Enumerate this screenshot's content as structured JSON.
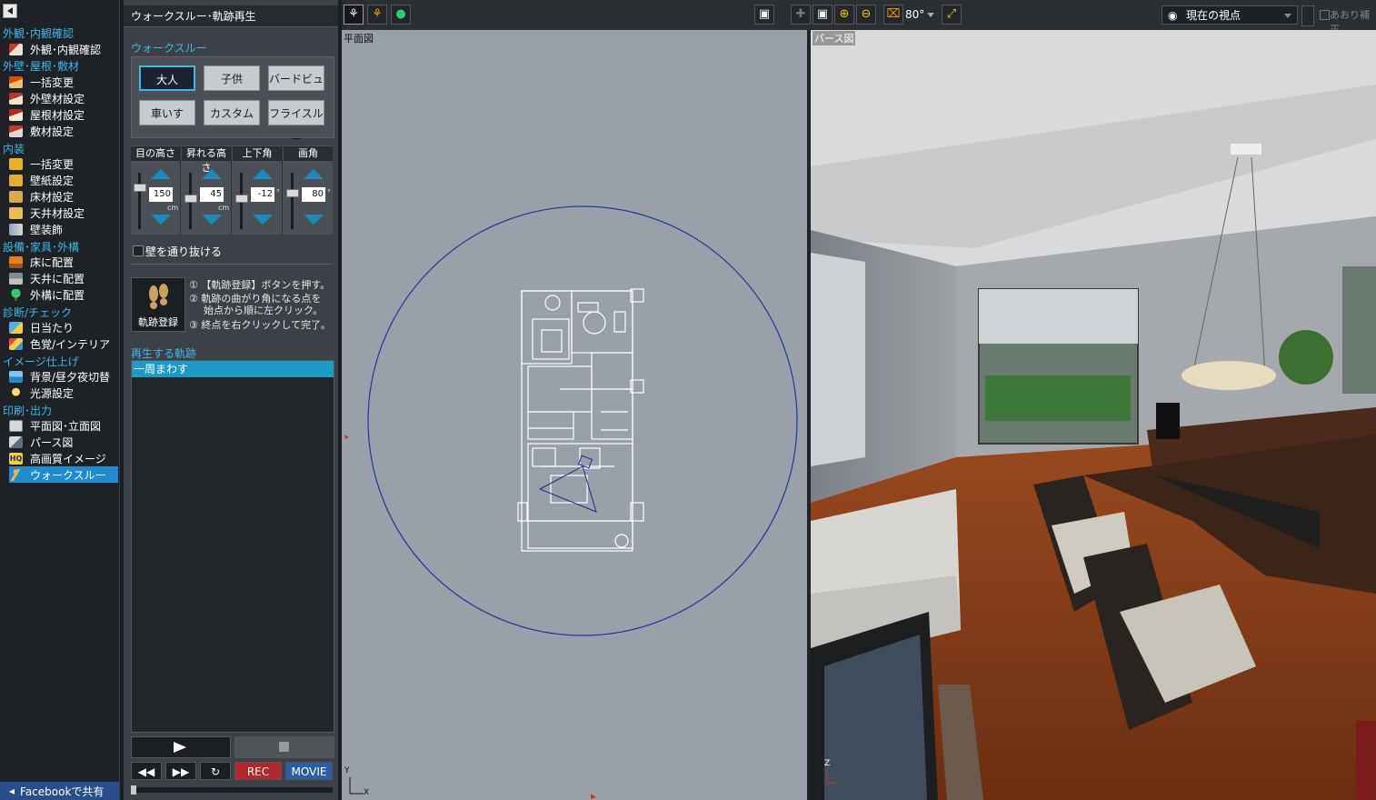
{
  "sidebar": {
    "groups": [
      {
        "label": "外観･内観確認",
        "items": [
          "外観･内観確認"
        ]
      },
      {
        "label": "外壁･屋根･敷材",
        "items": [
          "一括変更",
          "外壁材設定",
          "屋根材設定",
          "敷材設定"
        ]
      },
      {
        "label": "内装",
        "items": [
          "一括変更",
          "壁紙設定",
          "床材設定",
          "天井材設定",
          "壁装飾"
        ]
      },
      {
        "label": "設備･家具･外構",
        "items": [
          "床に配置",
          "天井に配置",
          "外構に配置"
        ]
      },
      {
        "label": "診断/チェック",
        "items": [
          "日当たり",
          "色覚/インテリア"
        ]
      },
      {
        "label": "イメージ仕上げ",
        "items": [
          "背景/昼夕夜切替",
          "光源設定"
        ]
      },
      {
        "label": "印刷･出力",
        "items": [
          "平面図･立面図",
          "パース図",
          "高画質イメージ",
          "ウォークスルー"
        ]
      }
    ],
    "selected": "ウォークスルー",
    "facebook": "Facebookで共有"
  },
  "panel": {
    "title": "ウォークスルー･軌跡再生",
    "walk_label": "ウォークスルー",
    "modes": [
      "大人",
      "子供",
      "バードビュー",
      "車いす",
      "カスタム",
      "フライスルー"
    ],
    "selected_mode": "大人",
    "sliders": [
      {
        "label": "目の高さ",
        "value": "150",
        "unit": "cm"
      },
      {
        "label": "昇れる高さ",
        "value": "45",
        "unit": "cm"
      },
      {
        "label": "上下角",
        "value": "-12",
        "unit": "°"
      },
      {
        "label": "画角",
        "value": "80",
        "unit": "°"
      }
    ],
    "wall_pass": "壁を通り抜ける",
    "record_button": "軌跡登録",
    "steps": [
      "① 【軌跡登録】ボタンを押す。",
      "② 軌跡の曲がり角になる点を",
      "始点から順に左クリック。",
      "③ 終点を右クリックして完了。"
    ],
    "track_label": "再生する軌跡",
    "tracks": [
      "一周まわす"
    ],
    "controls": {
      "rec": "REC",
      "movie": "MOVIE"
    }
  },
  "toolbar": {
    "fov": "80°",
    "viewpoint": "現在の視点",
    "tilt": "あおり補正"
  },
  "plan": {
    "label": "平面図",
    "axis_y": "Y",
    "axis_x": "X"
  },
  "persp": {
    "label": "パース図",
    "axis_z": "Z"
  }
}
